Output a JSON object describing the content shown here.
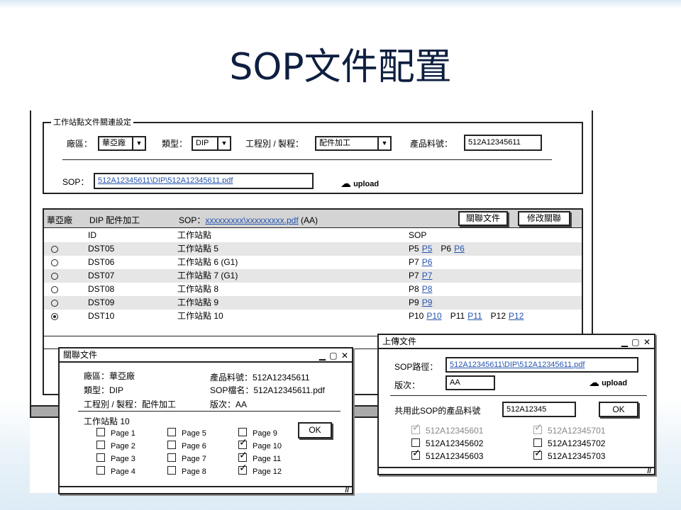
{
  "slide_title": "SOP文件配置",
  "settings": {
    "group_title": "工作站點文件關連設定",
    "plant_label": "廠區：",
    "plant_value": "華亞廠",
    "type_label": "類型：",
    "type_value": "DIP",
    "process_label": "工程別 / 製程：",
    "process_value": "配件加工",
    "part_label": "產品料號：",
    "part_value": "512A12345611",
    "sop_label": "SOP：",
    "sop_value": "512A12345611\\DIP\\512A12345611.pdf",
    "upload_label": "upload"
  },
  "grid": {
    "header_plant": "華亞廠",
    "header_type_process": "DIP  配件加工",
    "header_sop_label": "SOP：",
    "header_sop_link": "xxxxxxxxx\\xxxxxxxxx.pdf",
    "header_sop_suffix": "(AA)",
    "btn_link_doc": "關聯文件",
    "btn_edit_link": "修改關聯",
    "columns": [
      "ID",
      "工作站點",
      "SOP"
    ],
    "rows": [
      {
        "id": "DST05",
        "station": "工作站點 5",
        "sop": [
          [
            "P5",
            "P5"
          ],
          [
            "P6",
            "P6"
          ]
        ],
        "selected": false
      },
      {
        "id": "DST06",
        "station": "工作站點 6 (G1)",
        "sop": [
          [
            "P7",
            "P6"
          ]
        ],
        "selected": false
      },
      {
        "id": "DST07",
        "station": "工作站點 7 (G1)",
        "sop": [
          [
            "P7",
            "P7"
          ]
        ],
        "selected": false
      },
      {
        "id": "DST08",
        "station": "工作站點 8",
        "sop": [
          [
            "P8",
            "P8"
          ]
        ],
        "selected": false
      },
      {
        "id": "DST09",
        "station": "工作站點 9",
        "sop": [
          [
            "P9",
            "P9"
          ]
        ],
        "selected": false
      },
      {
        "id": "DST10",
        "station": "工作站點 10",
        "sop": [
          [
            "P10",
            "P10"
          ],
          [
            "P11",
            "P11"
          ],
          [
            "P12",
            "P12"
          ]
        ],
        "selected": true
      }
    ]
  },
  "link_dialog": {
    "title": "關聯文件",
    "controls": "▁ ▢ ✕",
    "plant": "廠區：華亞廠",
    "type": "類型：DIP",
    "process": "工程別 / 製程：配件加工",
    "part": "產品料號：512A12345611",
    "sop_name": "SOP檔名：512A12345611.pdf",
    "version": "版次：AA",
    "station": "工作站點 10",
    "ok_label": "OK",
    "pages": [
      {
        "label": "Page 1",
        "checked": false
      },
      {
        "label": "Page 2",
        "checked": false
      },
      {
        "label": "Page 3",
        "checked": false
      },
      {
        "label": "Page 4",
        "checked": false
      },
      {
        "label": "Page 5",
        "checked": false
      },
      {
        "label": "Page 6",
        "checked": false
      },
      {
        "label": "Page 7",
        "checked": false
      },
      {
        "label": "Page 8",
        "checked": false
      },
      {
        "label": "Page 9",
        "checked": false
      },
      {
        "label": "Page 10",
        "checked": true
      },
      {
        "label": "Page 11",
        "checked": true
      },
      {
        "label": "Page 12",
        "checked": true
      }
    ]
  },
  "upload_dialog": {
    "title": "上傳文件",
    "controls": "▁ ▢ ✕",
    "sop_path_label": "SOP路徑：",
    "sop_path_value": "512A12345611\\DIP\\512A12345611.pdf",
    "version_label": "版次：",
    "version_value": "AA",
    "upload_label": "upload",
    "shared_label": "共用此SOP的產品料號",
    "shared_value": "512A12345",
    "ok_label": "OK",
    "parts": [
      {
        "label": "512A12345601",
        "checked": true,
        "disabled": true
      },
      {
        "label": "512A12345701",
        "checked": true,
        "disabled": true
      },
      {
        "label": "512A12345602",
        "checked": false,
        "disabled": false
      },
      {
        "label": "512A12345702",
        "checked": false,
        "disabled": false
      },
      {
        "label": "512A12345603",
        "checked": true,
        "disabled": false
      },
      {
        "label": "512A12345703",
        "checked": true,
        "disabled": false
      }
    ]
  }
}
